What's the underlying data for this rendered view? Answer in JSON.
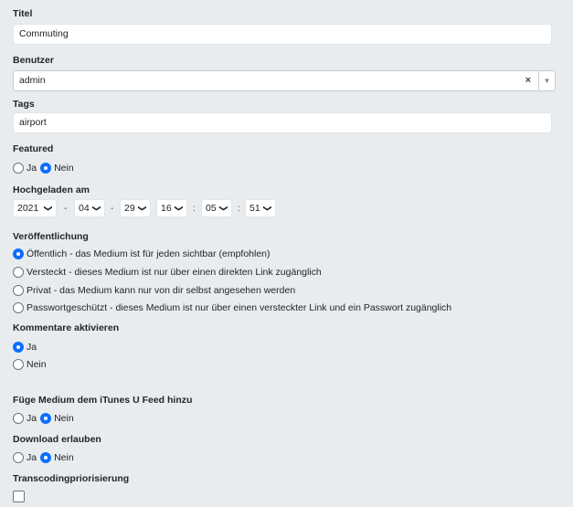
{
  "title": {
    "label": "Titel",
    "value": "Commuting"
  },
  "user": {
    "label": "Benutzer",
    "value": "admin",
    "clear_glyph": "×",
    "arrow_glyph": "▼"
  },
  "tags": {
    "label": "Tags",
    "value": "airport"
  },
  "featured": {
    "label": "Featured",
    "options": [
      "Ja",
      "Nein"
    ],
    "selected": "Nein"
  },
  "uploaded": {
    "label": "Hochgeladen am",
    "year": "2021",
    "month": "04",
    "day": "29",
    "hour": "16",
    "minute": "05",
    "second": "51",
    "date_sep": "-",
    "time_sep": ":",
    "chevron": "❯"
  },
  "visibility": {
    "label": "Veröffentlichung",
    "options": [
      "Öffentlich - das Medium ist für jeden sichtbar (empfohlen)",
      "Versteckt - dieses Medium ist nur über einen direkten Link zugänglich",
      "Privat - das Medium kann nur von dir selbst angesehen werden",
      "Passwortgeschützt - dieses Medium ist nur über einen versteckter Link und ein Passwort zugänglich"
    ],
    "selected_index": 0
  },
  "comments": {
    "label": "Kommentare aktivieren",
    "options": [
      "Ja",
      "Nein"
    ],
    "selected": "Ja"
  },
  "itunes": {
    "label": "Füge Medium dem iTunes U Feed hinzu",
    "options": [
      "Ja",
      "Nein"
    ],
    "selected": "Nein"
  },
  "download": {
    "label": "Download erlauben",
    "options": [
      "Ja",
      "Nein"
    ],
    "selected": "Nein"
  },
  "transcoding": {
    "label": "Transcodingpriorisierung",
    "checked": false
  },
  "colors": {
    "accent": "#0d6efd",
    "background": "#e9ecef"
  }
}
